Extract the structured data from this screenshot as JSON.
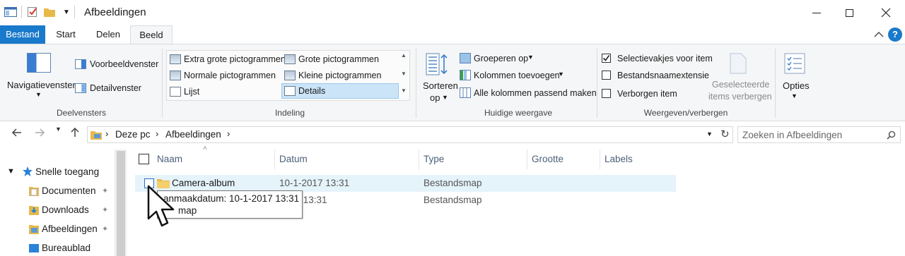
{
  "window": {
    "title": "Afbeeldingen"
  },
  "ribbon_tabs": [
    {
      "label": "Bestand"
    },
    {
      "label": "Start"
    },
    {
      "label": "Delen"
    },
    {
      "label": "Beeld"
    }
  ],
  "ribbon": {
    "panes": {
      "navigation_pane": "Navigatievenster",
      "preview_pane": "Voorbeeldvenster",
      "details_pane": "Detailvenster",
      "group_label": "Deelvensters"
    },
    "layout": {
      "items": [
        "Extra grote pictogrammen",
        "Grote pictogrammen",
        "Normale pictogrammen",
        "Kleine pictogrammen",
        "Lijst",
        "Details"
      ],
      "selected": "Details",
      "group_label": "Indeling"
    },
    "current_view": {
      "sort_line1": "Sorteren",
      "sort_line2": "op",
      "group_by": "Groeperen op",
      "add_columns": "Kolommen toevoegen",
      "size_all_columns": "Alle kolommen passend maken",
      "group_label": "Huidige weergave"
    },
    "show_hide": {
      "item_checkboxes": "Selectievakjes voor item",
      "item_checkboxes_checked": true,
      "file_name_extensions": "Bestandsnaamextensie",
      "file_name_extensions_checked": false,
      "hidden_items": "Verborgen item",
      "hidden_items_checked": false,
      "hide_selected_line1": "Geselecteerde",
      "hide_selected_line2": "items verbergen",
      "group_label": "Weergeven/verbergen"
    },
    "options": "Opties"
  },
  "address_bar": {
    "breadcrumbs": [
      "Deze pc",
      "Afbeeldingen"
    ]
  },
  "search": {
    "placeholder": "Zoeken in Afbeeldingen"
  },
  "nav_pane": {
    "items": [
      {
        "label": "Snelle toegang"
      },
      {
        "label": "Documenten"
      },
      {
        "label": "Downloads"
      },
      {
        "label": "Afbeeldingen"
      },
      {
        "label": "Bureaublad"
      }
    ]
  },
  "file_list": {
    "columns": [
      "Naam",
      "Datum",
      "Type",
      "Grootte",
      "Labels"
    ],
    "rows": [
      {
        "name": "Camera-album",
        "date": "10-1-2017 13:31",
        "type": "Bestandsmap"
      },
      {
        "name": "",
        "date": "2017 13:31",
        "type": "Bestandsmap"
      }
    ]
  },
  "tooltip": {
    "line1": "anmaakdatum: 10-1-2017 13:31",
    "line2": "map"
  },
  "colors": {
    "accent": "#1979ca",
    "hover_row": "#e5f3fb",
    "selected_layout": "#cce4f7",
    "folder": "#e8b94a"
  }
}
